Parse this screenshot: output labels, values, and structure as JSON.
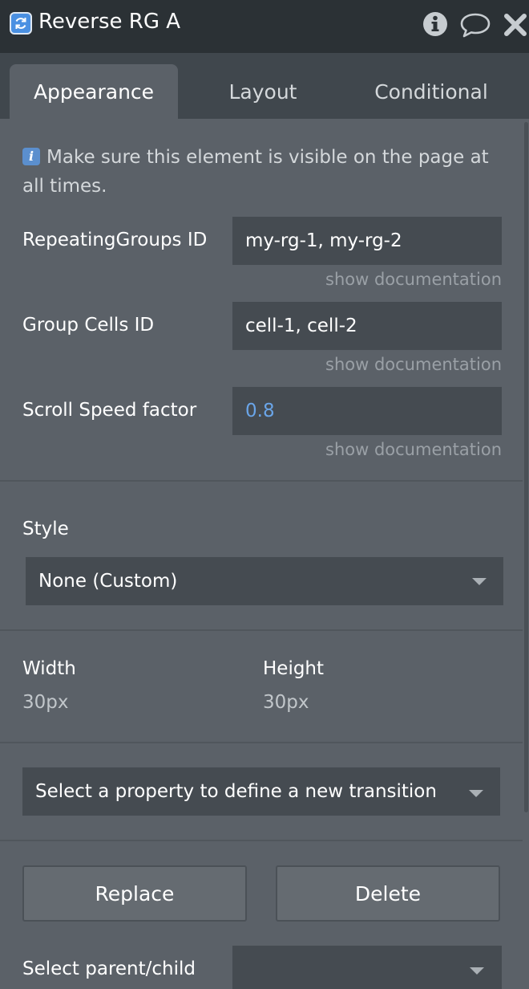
{
  "window": {
    "title": "Reverse RG A",
    "icons": [
      "refresh-icon",
      "info-icon",
      "comment-icon",
      "close-icon"
    ]
  },
  "tabs": [
    {
      "label": "Appearance",
      "active": true
    },
    {
      "label": "Layout",
      "active": false
    },
    {
      "label": "Conditional",
      "active": false
    }
  ],
  "note": {
    "text": "Make sure this element is visible on the page at all times."
  },
  "fields": [
    {
      "label": "RepeatingGroups ID",
      "value": "my-rg-1, my-rg-2",
      "doc_link": "show documentation"
    },
    {
      "label": "Group Cells ID",
      "value": "cell-1, cell-2",
      "doc_link": "show documentation"
    },
    {
      "label": "Scroll Speed factor",
      "value": "0.8",
      "doc_link": "show documentation"
    }
  ],
  "style": {
    "label": "Style",
    "selected": "None (Custom)"
  },
  "dimensions": {
    "width_label": "Width",
    "width_value": "30px",
    "height_label": "Height",
    "height_value": "30px"
  },
  "transition": {
    "placeholder": "Select a property to define a new transition"
  },
  "actions": {
    "replace_label": "Replace",
    "delete_label": "Delete"
  },
  "parent_child": {
    "label": "Select parent/child",
    "selected": ""
  },
  "colors": {
    "panel_bg": "#5b6168",
    "titlebar_bg": "#2b3135",
    "tabbar_bg": "#40474d",
    "input_bg": "#454b51",
    "accent_blue": "#6aa5e8"
  }
}
